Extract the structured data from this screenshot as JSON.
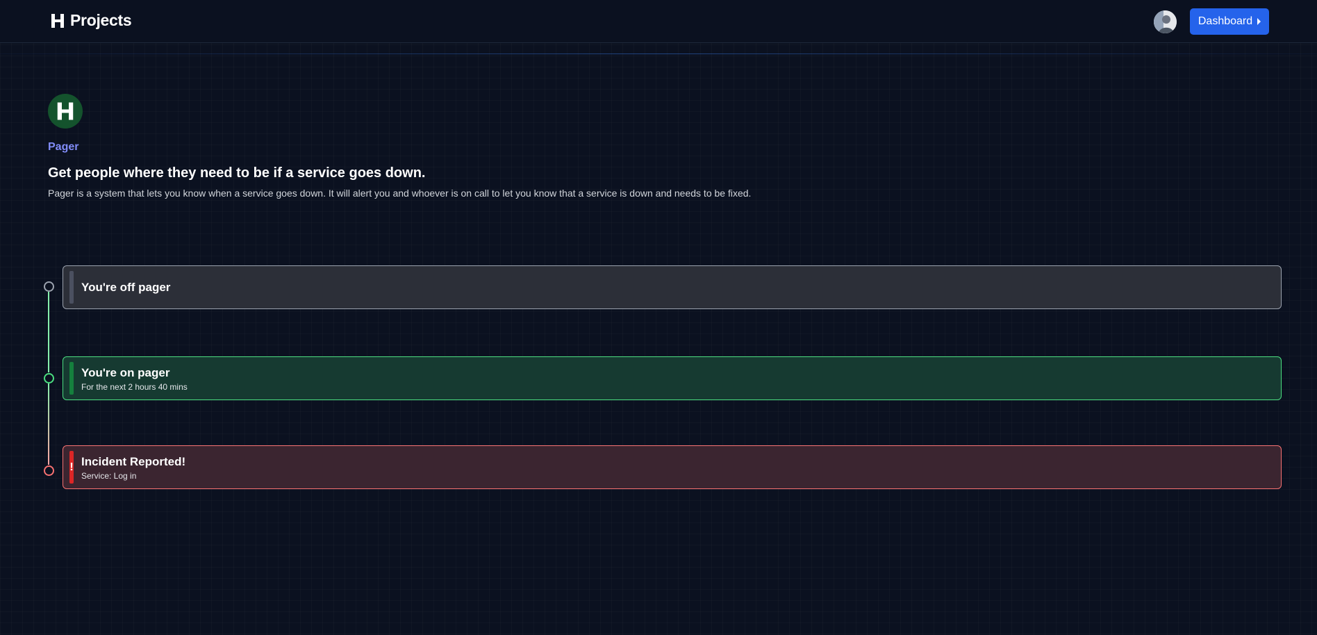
{
  "header": {
    "brand_name": "Projects",
    "dashboard_label": "Dashboard"
  },
  "project": {
    "name": "Pager",
    "tagline": "Get people where they need to be if a service goes down.",
    "description": "Pager is a system that lets you know when a service goes down. It will alert you and whoever is on call to let you know that a service is down and needs to be fixed."
  },
  "timeline": [
    {
      "title": "You're off pager",
      "subtitle": "",
      "status": "off",
      "color": "#9ca3af"
    },
    {
      "title": "You're on pager",
      "subtitle": "For the next 2 hours 40 mins",
      "status": "on",
      "color": "#4ade80"
    },
    {
      "title": "Incident Reported!",
      "subtitle": "Service: Log in",
      "status": "incident",
      "color": "#f87171"
    }
  ],
  "icons": {
    "brand": "h-logo-icon",
    "dashboard": "chevron-right-icon",
    "hero": "h-logo-icon",
    "incident": "exclamation-icon"
  },
  "colors": {
    "accent": "#2563eb",
    "project_label": "#818cf8",
    "success": "#4ade80",
    "danger": "#f87171",
    "neutral": "#9ca3af",
    "logo_bg": "#14532d"
  }
}
